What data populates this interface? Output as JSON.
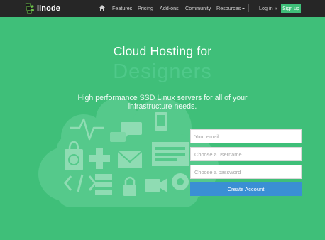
{
  "brand": {
    "name": "linode"
  },
  "nav": {
    "home_icon": "home-icon",
    "items": [
      {
        "label": "Features"
      },
      {
        "label": "Pricing"
      },
      {
        "label": "Add-ons"
      },
      {
        "label": "Community"
      },
      {
        "label": "Resources"
      }
    ],
    "login": "Log in »",
    "signup": "Sign up"
  },
  "hero": {
    "title": "Cloud Hosting for",
    "title_ghost": "Designers",
    "subtitle": "High performance SSD Linux servers for all of your infrastructure needs."
  },
  "form": {
    "email_placeholder": "Your email",
    "username_placeholder": "Choose a username",
    "password_placeholder": "Choose a password",
    "submit_label": "Create Account"
  },
  "colors": {
    "background": "#3fbf79",
    "nav": "#262626",
    "button": "#3a8fd4",
    "signup": "#3fbf79"
  }
}
